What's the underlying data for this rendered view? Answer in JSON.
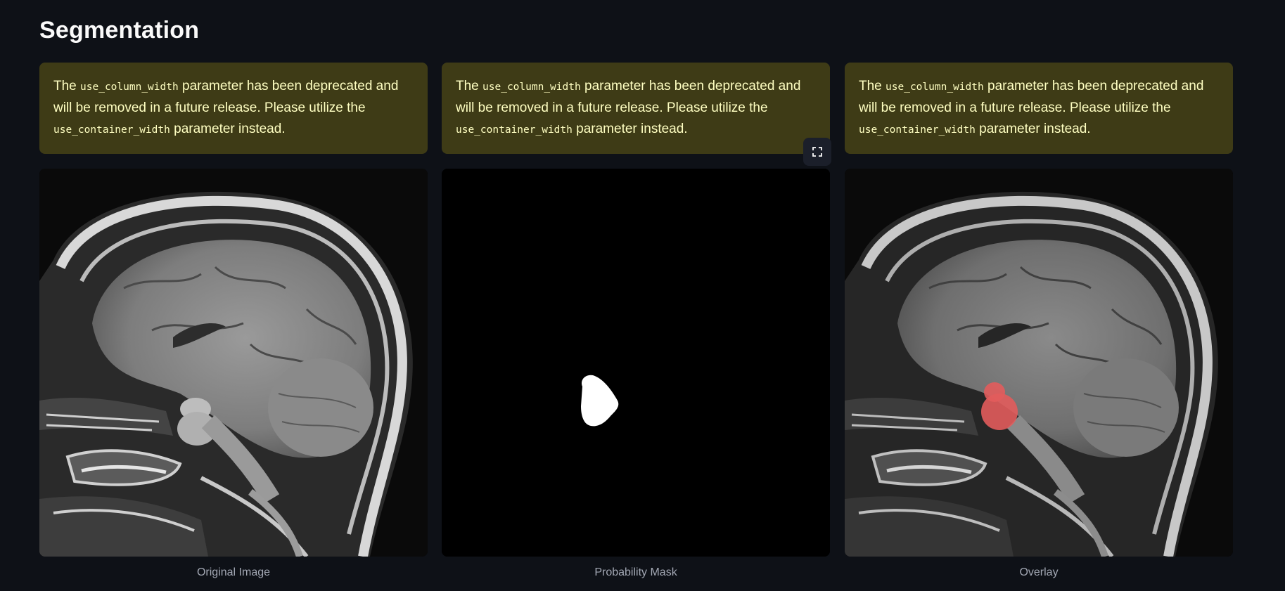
{
  "page": {
    "title": "Segmentation"
  },
  "alert": {
    "prefix": "The",
    "old_param": "use_column_width",
    "middle": "parameter has been deprecated and will be removed in a future release. Please utilize the",
    "new_param": "use_container_width",
    "suffix": "parameter instead."
  },
  "columns": [
    {
      "caption": "Original Image"
    },
    {
      "caption": "Probability Mask"
    },
    {
      "caption": "Overlay"
    }
  ],
  "icons": {
    "fullscreen": "fullscreen-icon"
  },
  "colors": {
    "background": "#0e1117",
    "alert_bg": "#3e3b16",
    "alert_text": "#ffffc2",
    "caption": "#a3a8b4",
    "overlay_highlight": "#e25c5c"
  }
}
